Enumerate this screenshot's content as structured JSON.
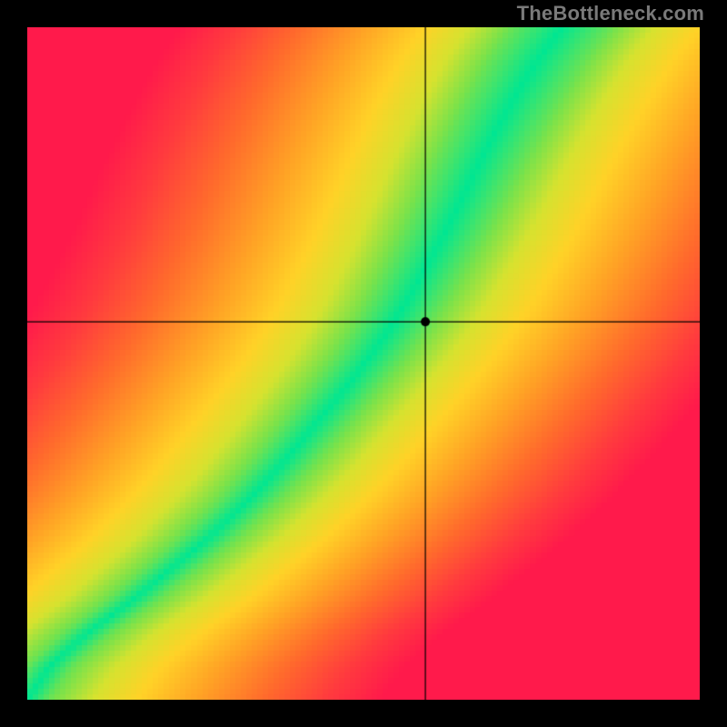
{
  "watermark": "TheBottleneck.com",
  "chart_data": {
    "type": "heatmap",
    "title": "",
    "xlabel": "",
    "ylabel": "",
    "xlim": [
      0,
      1
    ],
    "ylim": [
      0,
      1
    ],
    "crosshair": {
      "x": 0.592,
      "y": 0.562
    },
    "marker": {
      "x": 0.592,
      "y": 0.562
    },
    "ideal_curve_description": "Green ridge follows a monotone increasing S-shaped curve from lower-left to upper-right; distance from the ridge maps green → yellow → orange → red; outer pixels are black frame.",
    "control_points": [
      {
        "y": 0.0,
        "x": 0.0
      },
      {
        "y": 0.05,
        "x": 0.034
      },
      {
        "y": 0.1,
        "x": 0.09
      },
      {
        "y": 0.15,
        "x": 0.159
      },
      {
        "y": 0.2,
        "x": 0.22
      },
      {
        "y": 0.25,
        "x": 0.279
      },
      {
        "y": 0.3,
        "x": 0.332
      },
      {
        "y": 0.35,
        "x": 0.378
      },
      {
        "y": 0.4,
        "x": 0.42
      },
      {
        "y": 0.45,
        "x": 0.462
      },
      {
        "y": 0.5,
        "x": 0.502
      },
      {
        "y": 0.55,
        "x": 0.538
      },
      {
        "y": 0.6,
        "x": 0.569
      },
      {
        "y": 0.65,
        "x": 0.597
      },
      {
        "y": 0.7,
        "x": 0.624
      },
      {
        "y": 0.75,
        "x": 0.649
      },
      {
        "y": 0.8,
        "x": 0.674
      },
      {
        "y": 0.85,
        "x": 0.7
      },
      {
        "y": 0.9,
        "x": 0.728
      },
      {
        "y": 0.95,
        "x": 0.758
      },
      {
        "y": 1.0,
        "x": 0.795
      }
    ],
    "ridge_half_width_frac": 0.045,
    "color_stops": [
      {
        "t": 0.0,
        "color": "#00e692"
      },
      {
        "t": 0.12,
        "color": "#7be24a"
      },
      {
        "t": 0.22,
        "color": "#d6e22f"
      },
      {
        "t": 0.34,
        "color": "#ffd227"
      },
      {
        "t": 0.5,
        "color": "#ffa225"
      },
      {
        "t": 0.68,
        "color": "#ff6a2c"
      },
      {
        "t": 0.85,
        "color": "#ff3a3e"
      },
      {
        "t": 1.0,
        "color": "#ff1a4b"
      }
    ]
  }
}
